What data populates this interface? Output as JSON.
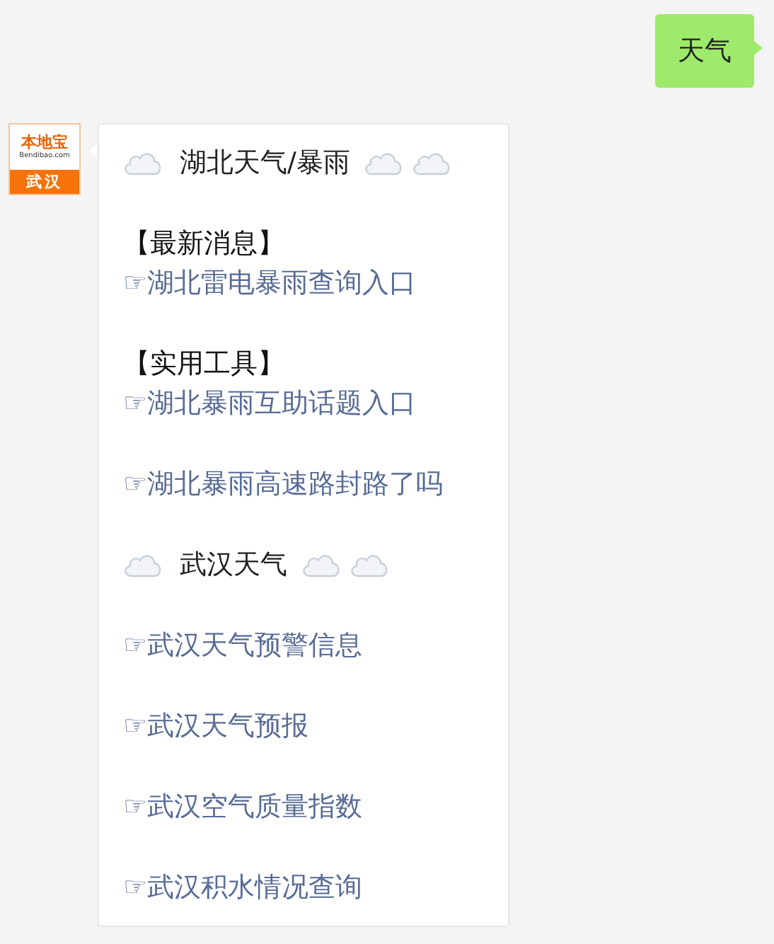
{
  "messages": [
    {
      "kind": "outgoing",
      "text": "天气"
    },
    {
      "kind": "incoming",
      "avatar": {
        "brand": "本地宝",
        "site": "Bendibao.com",
        "city": "武汉"
      },
      "groups": [
        [
          {
            "kind": "heading",
            "text": "湖北天气/暴雨"
          }
        ],
        [
          {
            "kind": "label",
            "text": "【最新消息】"
          },
          {
            "kind": "link",
            "text": "☞湖北雷电暴雨查询入口"
          }
        ],
        [
          {
            "kind": "label",
            "text": "【实用工具】"
          },
          {
            "kind": "link",
            "text": "☞湖北暴雨互助话题入口"
          }
        ],
        [
          {
            "kind": "link",
            "text": "☞湖北暴雨高速路封路了吗"
          }
        ],
        [
          {
            "kind": "heading",
            "text": "武汉天气"
          }
        ],
        [
          {
            "kind": "link",
            "text": "☞武汉天气预警信息"
          }
        ],
        [
          {
            "kind": "link",
            "text": "☞武汉天气预报"
          }
        ],
        [
          {
            "kind": "link",
            "text": "☞武汉空气质量指数"
          }
        ],
        [
          {
            "kind": "link",
            "text": "☞武汉积水情况查询"
          }
        ]
      ]
    }
  ]
}
